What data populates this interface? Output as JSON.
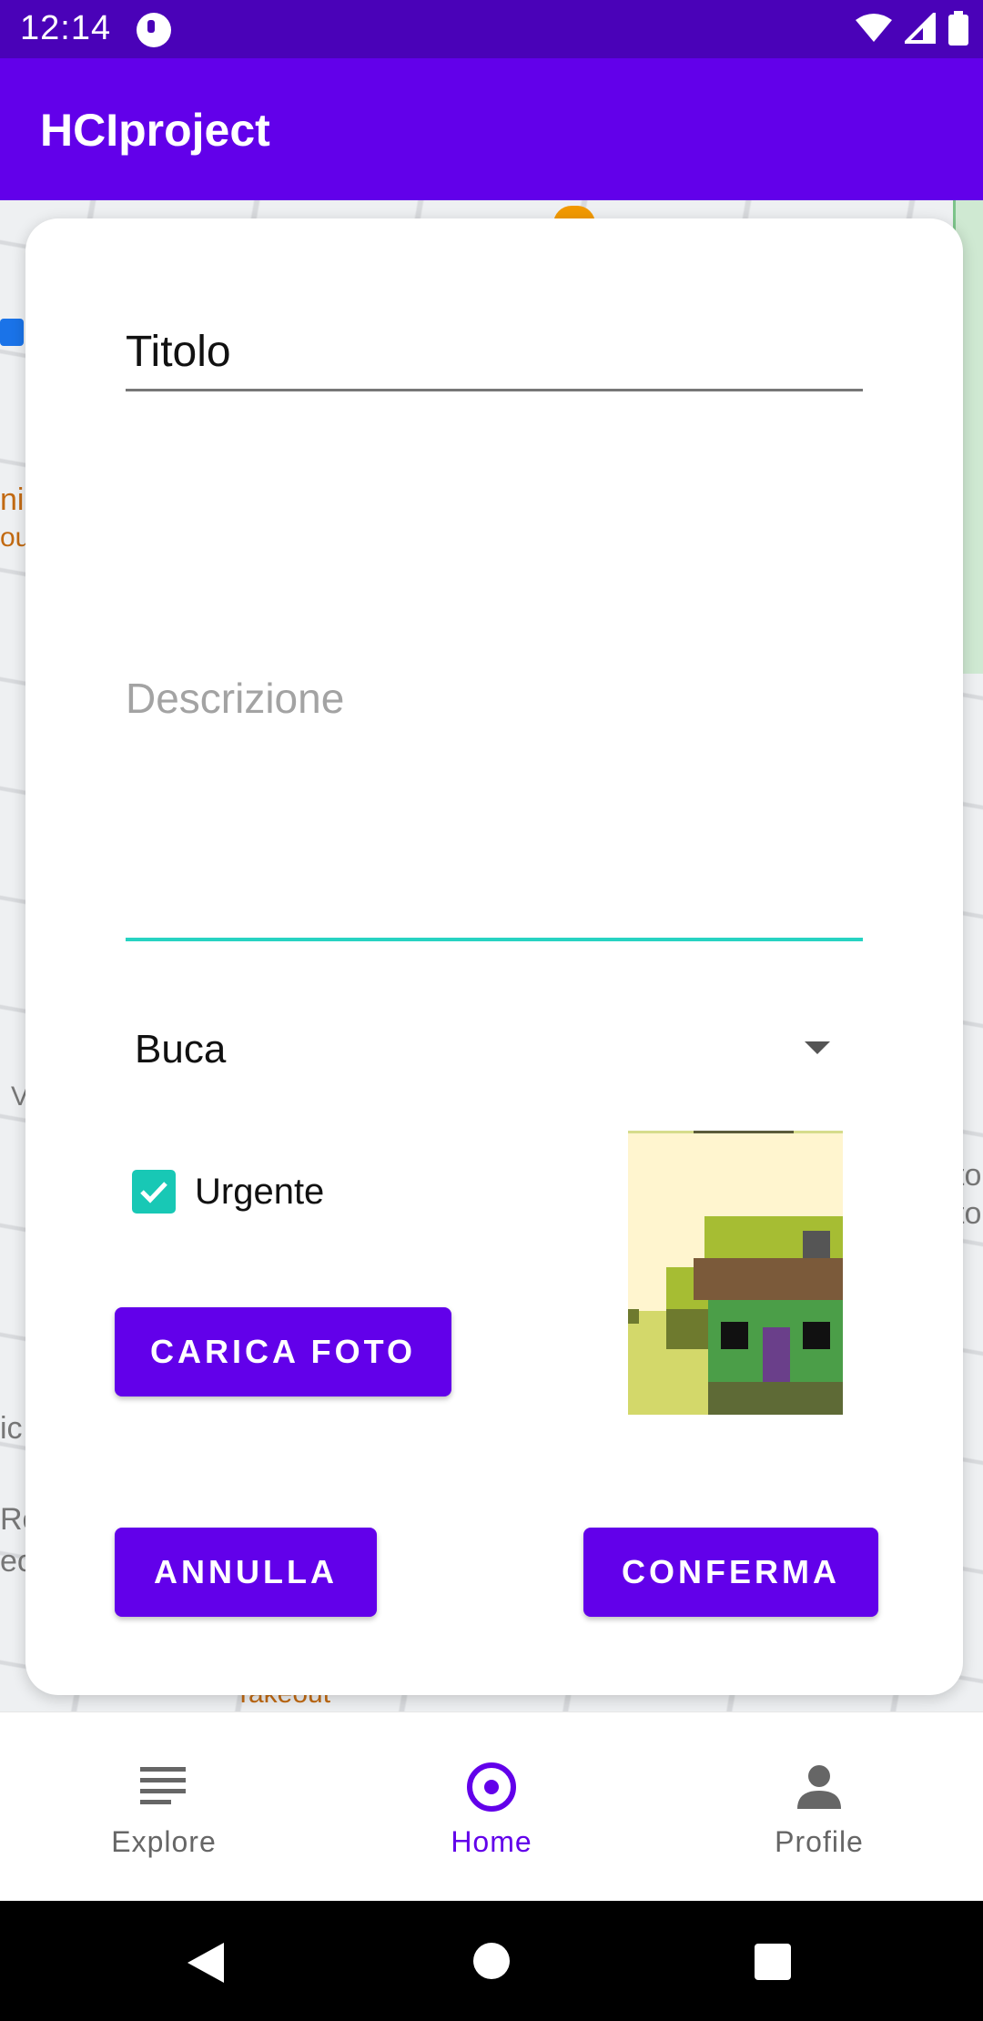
{
  "status_bar": {
    "time": "12:14"
  },
  "app_bar": {
    "title": "HCIproject"
  },
  "map": {
    "texts": [
      "ni",
      "ou",
      "V",
      "ic",
      "Ro",
      "ec",
      "to",
      "to",
      "Takeout"
    ]
  },
  "dialog": {
    "title_field": {
      "value": "Titolo",
      "placeholder": "Titolo"
    },
    "description_field": {
      "value": "",
      "placeholder": "Descrizione"
    },
    "category_select": {
      "selected": "Buca"
    },
    "urgent_checkbox": {
      "label": "Urgente",
      "checked": true
    },
    "upload_button": "CARICA FOTO",
    "cancel_button": "ANNULLA",
    "confirm_button": "CONFERMA"
  },
  "bottom_nav": {
    "items": [
      {
        "label": "Explore",
        "icon": "list-icon",
        "active": false
      },
      {
        "label": "Home",
        "icon": "location-pin-icon",
        "active": true
      },
      {
        "label": "Profile",
        "icon": "person-icon",
        "active": false
      }
    ]
  },
  "colors": {
    "primary": "#6200ea",
    "status_bar": "#4a02b8",
    "accent": "#18c8b5",
    "inactive_nav": "#666666"
  }
}
